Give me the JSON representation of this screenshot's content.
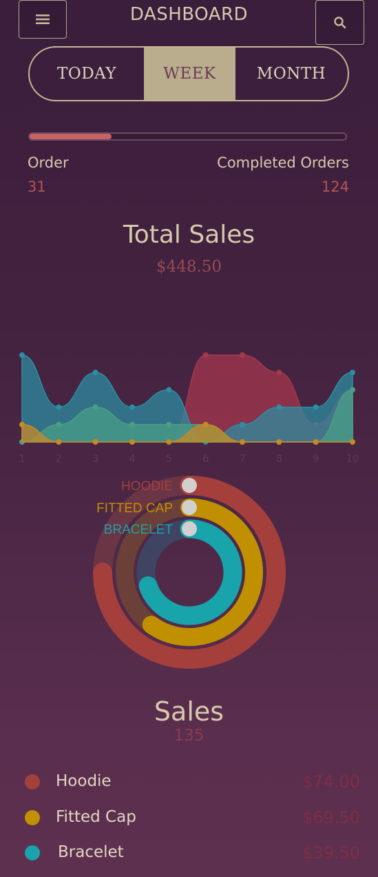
{
  "header": {
    "title": "DASHBOARD",
    "menu_icon": "hamburger-icon",
    "search_icon": "search-icon"
  },
  "tabs": [
    {
      "label": "TODAY",
      "selected": false
    },
    {
      "label": "WEEK",
      "selected": true
    },
    {
      "label": "MONTH",
      "selected": false
    }
  ],
  "progress": {
    "fraction": 0.26,
    "fill_color": "#c56462"
  },
  "stats": {
    "order_label": "Order",
    "order_value": "31",
    "completed_label": "Completed Orders",
    "completed_value": "124"
  },
  "total_sales": {
    "title": "Total Sales",
    "value": "$448.50"
  },
  "chart_data": [
    {
      "type": "area",
      "title": "",
      "x": [
        1,
        2,
        3,
        4,
        5,
        6,
        7,
        8,
        9,
        10
      ],
      "xlabel": "",
      "ylabel": "",
      "ylim": [
        0,
        5
      ],
      "grid": false,
      "series": [
        {
          "color": "#a6374d",
          "values": [
            1,
            0,
            0,
            0,
            0,
            5,
            5,
            4,
            1,
            3
          ]
        },
        {
          "color": "#2b8fa3",
          "values": [
            5,
            2,
            4,
            2,
            3,
            0,
            1,
            2,
            2,
            4
          ]
        },
        {
          "color": "#4a9f86",
          "values": [
            0,
            1,
            2,
            1,
            1,
            1,
            0,
            0,
            0,
            3
          ]
        },
        {
          "color": "#c68a24",
          "values": [
            1,
            0,
            0,
            0,
            0,
            1,
            0,
            0,
            0,
            0
          ]
        }
      ]
    },
    {
      "type": "pie",
      "title": "",
      "labels": [
        "HOODIE",
        "FITTED CAP",
        "BRACELET"
      ],
      "values": [
        0.75,
        0.6,
        0.7
      ],
      "colors": [
        "#a53f3c",
        "#c09000",
        "#19a3aa"
      ]
    }
  ],
  "sales": {
    "title": "Sales",
    "value": "135"
  },
  "legend": [
    {
      "name": "Hoodie",
      "price": "$74.00",
      "color": "#a3403a"
    },
    {
      "name": "Fitted Cap",
      "price": "$69.50",
      "color": "#c09200"
    },
    {
      "name": "Bracelet",
      "price": "$39.50",
      "color": "#1aa2ad"
    }
  ]
}
